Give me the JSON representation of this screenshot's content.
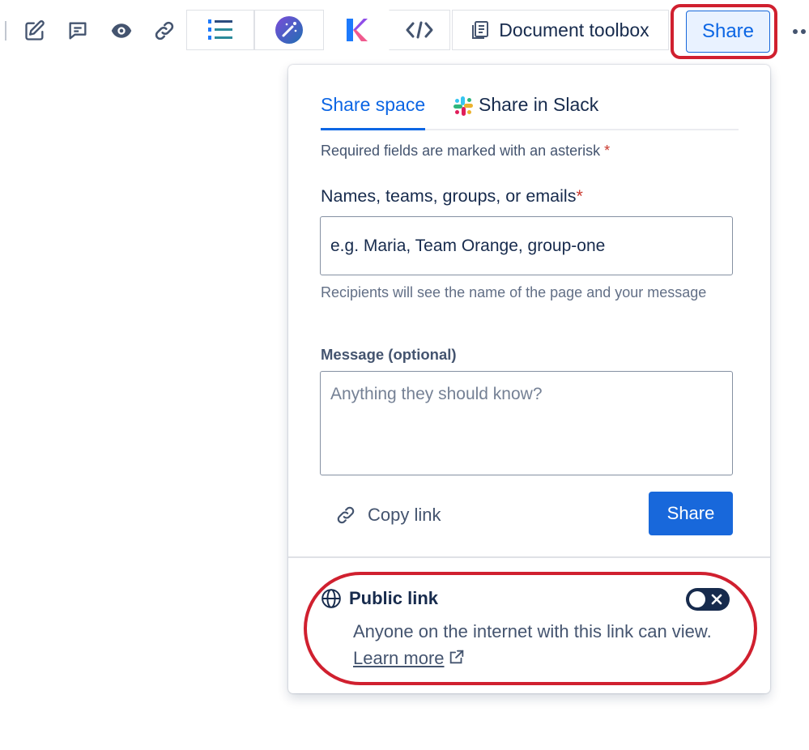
{
  "toolbar": {
    "icons": [
      "edit-icon",
      "comment-icon",
      "watch-icon",
      "link-icon",
      "numbered-list-icon",
      "ai-wand-icon",
      "k-app-icon",
      "code-icon"
    ],
    "document_toolbox_label": "Document toolbox",
    "share_label": "Share",
    "more_icon": "more-horizontal-icon"
  },
  "popup": {
    "tabs": [
      {
        "label": "Share space",
        "selected": true
      },
      {
        "label": "Share in Slack",
        "icon": "slack-icon",
        "selected": false
      }
    ],
    "required_note": "Required fields are marked with an asterisk",
    "asterisk": "*",
    "names_label": "Names, teams, groups, or emails",
    "names_placeholder": "e.g. Maria, Team Orange, group-one",
    "recipients_help": "Recipients will see the name of the page and your message",
    "message_label": "Message (optional)",
    "message_placeholder": "Anything they should know?",
    "copy_link_label": "Copy link",
    "share_button_label": "Share",
    "public_link": {
      "title": "Public link",
      "description": "Anyone on the internet with this link can view.",
      "learn_more": "Learn more",
      "enabled": false
    }
  },
  "colors": {
    "primary": "#1868db",
    "link_blue": "#0c66e4",
    "highlight_ring": "#d0202f",
    "text": "#172b4d",
    "subtle_text": "#626f86"
  }
}
